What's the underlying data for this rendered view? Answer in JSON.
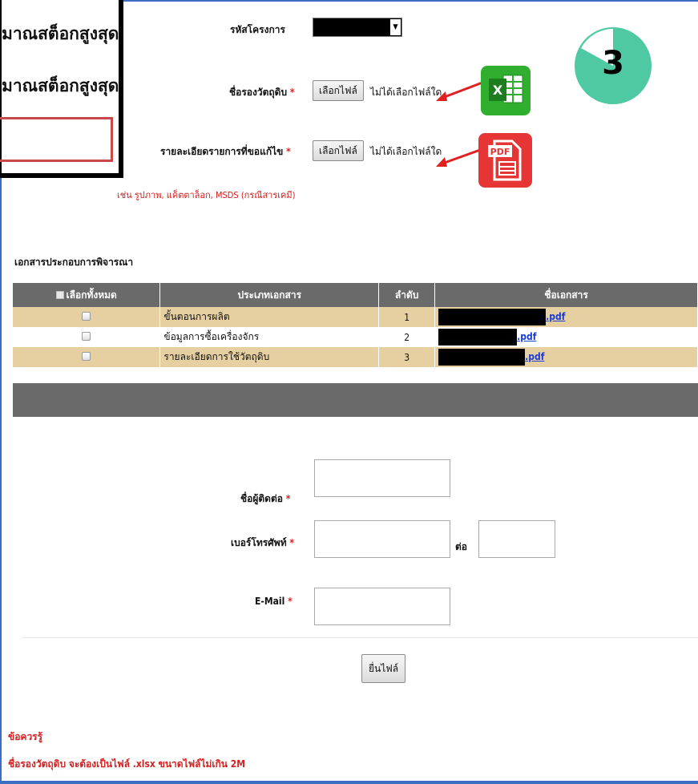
{
  "zoom_callout": {
    "line1": "มาณสต็อกสูงสุด",
    "line2": "มาณสต็อกสูงสุด"
  },
  "form": {
    "project_code_label": "รหัสโครงการ",
    "raw_material_label": "ชื่อรองวัตถุดิบ",
    "detail_label": "รายละเอียดรายการที่ขอแก้ไข",
    "required_mark": "*",
    "choose_file_label": "เลือกไฟล์",
    "no_file_label": "ไม่ได้เลือกไฟล์ใด",
    "hint": "เช่น รูปภาพ, แค็ตตาล็อก, MSDS (กรณีสารเคมี)",
    "dropdown_arrow": "▼"
  },
  "icons": {
    "excel": "excel-file-icon",
    "pdf": "pdf-file-icon",
    "pdf_tag": "PDF",
    "excel_letter": "X"
  },
  "step_badge": {
    "number": "3",
    "color": "#4ec9a3"
  },
  "documents": {
    "section_title": "เอกสารประกอบการพิจารณา",
    "headers": {
      "select_all": "เลือกทั้งหมด",
      "doc_type": "ประเภทเอกสาร",
      "order": "ลำดับ",
      "doc_name": "ชื่อเอกสาร"
    },
    "rows": [
      {
        "type": "ขั้นตอนการผลิต",
        "order": "1",
        "file_suffix": ".pdf"
      },
      {
        "type": "ข้อมูลการซื้อเครื่องจักร",
        "order": "2",
        "file_suffix": ".pdf"
      },
      {
        "type": "รายละเอียดการใช้วัตถุดิบ",
        "order": "3",
        "file_suffix": ".pdf"
      }
    ]
  },
  "contact": {
    "contact_name_label": "ชื่อผู้ติดต่อ",
    "phone_label": "เบอร์โทรศัพท์",
    "extension_label": "ต่อ",
    "email_label": "E-Mail",
    "contact_name_value": "",
    "phone_value": "",
    "extension_value": "",
    "email_value": ""
  },
  "submit_label": "ยื่นไฟล์",
  "note": {
    "title": "ข้อควรรู้",
    "body": "ชื่อรองวัตถุดิบ จะต้องเป็นไฟล์ .xlsx ขนาดไฟล์ไม่เกิน 2M"
  },
  "colors": {
    "frame": "#3a6fc4",
    "table_header": "#6a6a6a",
    "row_highlight": "#e6cfa1",
    "required": "#e02020",
    "link": "#1a3bd8"
  }
}
